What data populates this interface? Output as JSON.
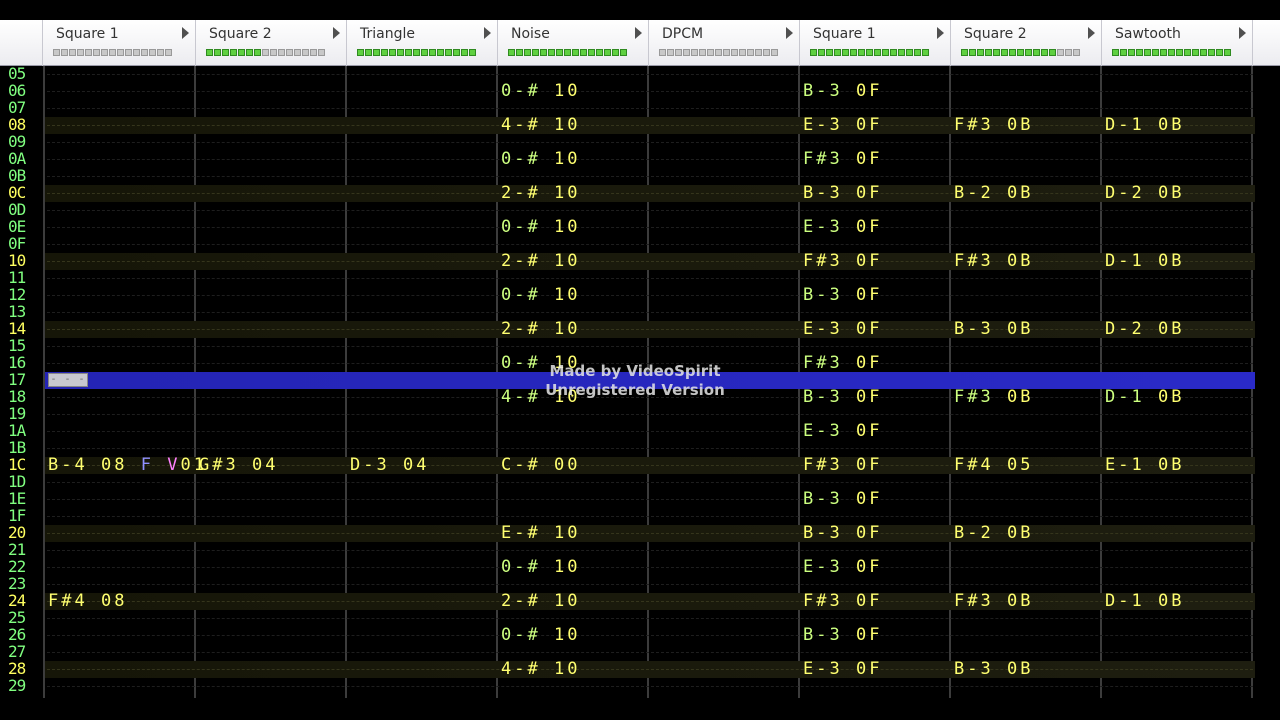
{
  "channels": [
    {
      "name": "Square 1",
      "meter": [
        0,
        0,
        0,
        0,
        0,
        0,
        0,
        0,
        0,
        0,
        0,
        0,
        0,
        0,
        0
      ]
    },
    {
      "name": "Square 2",
      "meter": [
        1,
        1,
        1,
        1,
        1,
        1,
        1,
        0,
        0,
        0,
        0,
        0,
        0,
        0,
        0
      ]
    },
    {
      "name": "Triangle",
      "meter": [
        1,
        1,
        1,
        1,
        1,
        1,
        1,
        1,
        1,
        1,
        1,
        1,
        1,
        1,
        1
      ]
    },
    {
      "name": "Noise",
      "meter": [
        1,
        1,
        1,
        1,
        1,
        1,
        1,
        1,
        1,
        1,
        1,
        1,
        1,
        1,
        1
      ]
    },
    {
      "name": "DPCM",
      "meter": [
        0,
        0,
        0,
        0,
        0,
        0,
        0,
        0,
        0,
        0,
        0,
        0,
        0,
        0,
        0
      ]
    },
    {
      "name": "Square 1",
      "meter": [
        1,
        1,
        1,
        1,
        1,
        1,
        1,
        1,
        1,
        1,
        1,
        1,
        1,
        1,
        1
      ]
    },
    {
      "name": "Square 2",
      "meter": [
        1,
        1,
        1,
        1,
        1,
        1,
        1,
        1,
        1,
        1,
        1,
        1,
        0,
        0,
        0
      ]
    },
    {
      "name": "Sawtooth",
      "meter": [
        1,
        1,
        1,
        1,
        1,
        1,
        1,
        1,
        1,
        1,
        1,
        1,
        1,
        1,
        1
      ]
    }
  ],
  "rows": [
    {
      "num": "05",
      "hl": false,
      "cells": []
    },
    {
      "num": "06",
      "hl": false,
      "cells": [
        {
          "ch": 3,
          "note": "0-#",
          "vol": "10"
        },
        {
          "ch": 5,
          "note": "B-3",
          "vol": "0F"
        }
      ]
    },
    {
      "num": "07",
      "hl": false,
      "cells": []
    },
    {
      "num": "08",
      "hl": true,
      "cells": [
        {
          "ch": 3,
          "note": "4-#",
          "vol": "10"
        },
        {
          "ch": 5,
          "note": "E-3",
          "vol": "0F"
        },
        {
          "ch": 6,
          "note": "F#3",
          "vol": "0B"
        },
        {
          "ch": 7,
          "note": "D-1",
          "vol": "0B"
        }
      ]
    },
    {
      "num": "09",
      "hl": false,
      "cells": []
    },
    {
      "num": "0A",
      "hl": false,
      "cells": [
        {
          "ch": 3,
          "note": "0-#",
          "vol": "10"
        },
        {
          "ch": 5,
          "note": "F#3",
          "vol": "0F"
        }
      ]
    },
    {
      "num": "0B",
      "hl": false,
      "cells": []
    },
    {
      "num": "0C",
      "hl": true,
      "cells": [
        {
          "ch": 3,
          "note": "2-#",
          "vol": "10"
        },
        {
          "ch": 5,
          "note": "B-3",
          "vol": "0F"
        },
        {
          "ch": 6,
          "note": "B-2",
          "vol": "0B"
        },
        {
          "ch": 7,
          "note": "D-2",
          "vol": "0B"
        }
      ]
    },
    {
      "num": "0D",
      "hl": false,
      "cells": []
    },
    {
      "num": "0E",
      "hl": false,
      "cells": [
        {
          "ch": 3,
          "note": "0-#",
          "vol": "10"
        },
        {
          "ch": 5,
          "note": "E-3",
          "vol": "0F"
        }
      ]
    },
    {
      "num": "0F",
      "hl": false,
      "cells": []
    },
    {
      "num": "10",
      "hl": true,
      "cells": [
        {
          "ch": 3,
          "note": "2-#",
          "vol": "10"
        },
        {
          "ch": 5,
          "note": "F#3",
          "vol": "0F"
        },
        {
          "ch": 6,
          "note": "F#3",
          "vol": "0B"
        },
        {
          "ch": 7,
          "note": "D-1",
          "vol": "0B"
        }
      ]
    },
    {
      "num": "11",
      "hl": false,
      "cells": []
    },
    {
      "num": "12",
      "hl": false,
      "cells": [
        {
          "ch": 3,
          "note": "0-#",
          "vol": "10"
        },
        {
          "ch": 5,
          "note": "B-3",
          "vol": "0F"
        }
      ]
    },
    {
      "num": "13",
      "hl": false,
      "cells": []
    },
    {
      "num": "14",
      "hl": true,
      "cells": [
        {
          "ch": 3,
          "note": "2-#",
          "vol": "10"
        },
        {
          "ch": 5,
          "note": "E-3",
          "vol": "0F"
        },
        {
          "ch": 6,
          "note": "B-3",
          "vol": "0B"
        },
        {
          "ch": 7,
          "note": "D-2",
          "vol": "0B"
        }
      ]
    },
    {
      "num": "15",
      "hl": false,
      "cells": []
    },
    {
      "num": "16",
      "hl": false,
      "cells": [
        {
          "ch": 3,
          "note": "0-#",
          "vol": "10"
        },
        {
          "ch": 5,
          "note": "F#3",
          "vol": "0F"
        }
      ]
    },
    {
      "num": "17",
      "hl": false,
      "cursor": true,
      "cells": []
    },
    {
      "num": "18",
      "hl": false,
      "cells": [
        {
          "ch": 3,
          "note": "4-#",
          "vol": "10"
        },
        {
          "ch": 5,
          "note": "B-3",
          "vol": "0F"
        },
        {
          "ch": 6,
          "note": "F#3",
          "vol": "0B"
        },
        {
          "ch": 7,
          "note": "D-1",
          "vol": "0B"
        }
      ]
    },
    {
      "num": "19",
      "hl": false,
      "cells": []
    },
    {
      "num": "1A",
      "hl": false,
      "cells": [
        {
          "ch": 5,
          "note": "E-3",
          "vol": "0F"
        }
      ]
    },
    {
      "num": "1B",
      "hl": false,
      "cells": []
    },
    {
      "num": "1C",
      "hl": true,
      "cells": [
        {
          "ch": 0,
          "note": "B-4",
          "vol": "08",
          "fx": "F",
          "fxv": "V",
          "fxn": "01"
        },
        {
          "ch": 1,
          "note": "G#3",
          "vol": "04"
        },
        {
          "ch": 2,
          "note": "D-3",
          "vol": "04"
        },
        {
          "ch": 3,
          "note": "C-#",
          "vol": "00"
        },
        {
          "ch": 5,
          "note": "F#3",
          "vol": "0F"
        },
        {
          "ch": 6,
          "note": "F#4",
          "vol": "05"
        },
        {
          "ch": 7,
          "note": "E-1",
          "vol": "0B"
        }
      ]
    },
    {
      "num": "1D",
      "hl": false,
      "cells": []
    },
    {
      "num": "1E",
      "hl": false,
      "cells": [
        {
          "ch": 5,
          "note": "B-3",
          "vol": "0F"
        }
      ]
    },
    {
      "num": "1F",
      "hl": false,
      "cells": []
    },
    {
      "num": "20",
      "hl": true,
      "cells": [
        {
          "ch": 3,
          "note": "E-#",
          "vol": "10"
        },
        {
          "ch": 5,
          "note": "B-3",
          "vol": "0F"
        },
        {
          "ch": 6,
          "note": "B-2",
          "vol": "0B"
        }
      ]
    },
    {
      "num": "21",
      "hl": false,
      "cells": []
    },
    {
      "num": "22",
      "hl": false,
      "cells": [
        {
          "ch": 3,
          "note": "0-#",
          "vol": "10"
        },
        {
          "ch": 5,
          "note": "E-3",
          "vol": "0F"
        }
      ]
    },
    {
      "num": "23",
      "hl": false,
      "cells": []
    },
    {
      "num": "24",
      "hl": true,
      "cells": [
        {
          "ch": 0,
          "note": "F#4",
          "vol": "08"
        },
        {
          "ch": 3,
          "note": "2-#",
          "vol": "10"
        },
        {
          "ch": 5,
          "note": "F#3",
          "vol": "0F"
        },
        {
          "ch": 6,
          "note": "F#3",
          "vol": "0B"
        },
        {
          "ch": 7,
          "note": "D-1",
          "vol": "0B"
        }
      ]
    },
    {
      "num": "25",
      "hl": false,
      "cells": []
    },
    {
      "num": "26",
      "hl": false,
      "cells": [
        {
          "ch": 3,
          "note": "0-#",
          "vol": "10"
        },
        {
          "ch": 5,
          "note": "B-3",
          "vol": "0F"
        }
      ]
    },
    {
      "num": "27",
      "hl": false,
      "cells": []
    },
    {
      "num": "28",
      "hl": true,
      "cells": [
        {
          "ch": 3,
          "note": "4-#",
          "vol": "10"
        },
        {
          "ch": 5,
          "note": "E-3",
          "vol": "0F"
        },
        {
          "ch": 6,
          "note": "B-3",
          "vol": "0B"
        }
      ]
    },
    {
      "num": "29",
      "hl": false,
      "cells": []
    }
  ],
  "cursor_placeholder": "- - -",
  "watermark": {
    "line1": "Made by VideoSpirit",
    "line2": "Unregistered Version"
  }
}
